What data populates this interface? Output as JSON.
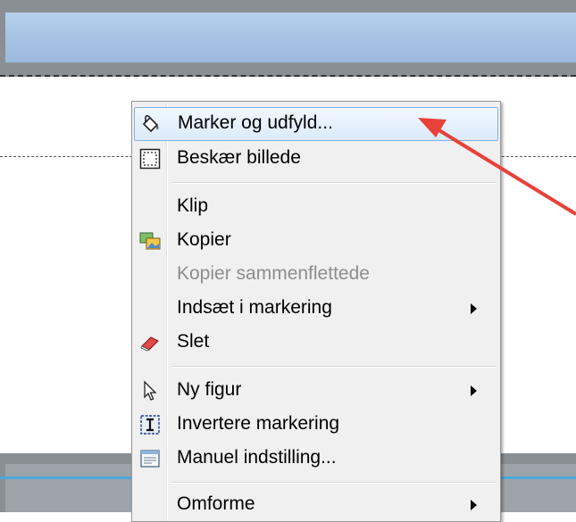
{
  "menu": {
    "items": [
      {
        "label": "Marker og udfyld...",
        "icon": "paint-bucket-icon",
        "highlighted": true
      },
      {
        "label": "Beskær billede",
        "icon": "crop-icon"
      },
      {
        "label": "Klip",
        "icon": ""
      },
      {
        "label": "Kopier",
        "icon": "copy-images-icon"
      },
      {
        "label": "Kopier sammenflettede",
        "icon": "",
        "disabled": true
      },
      {
        "label": "Indsæt i markering",
        "icon": "",
        "submenu": true
      },
      {
        "label": "Slet",
        "icon": "eraser-icon"
      },
      {
        "label": "Ny figur",
        "icon": "cursor-arrow-icon",
        "submenu": true
      },
      {
        "label": "Invertere markering",
        "icon": "invert-selection-icon"
      },
      {
        "label": "Manuel indstilling...",
        "icon": "window-settings-icon"
      },
      {
        "label": "Omforme",
        "icon": "",
        "submenu": true
      }
    ]
  },
  "colors": {
    "highlight_border": "#7fb0e6",
    "arrow": "#e8413a",
    "disabled_text": "#8d8d8d"
  }
}
